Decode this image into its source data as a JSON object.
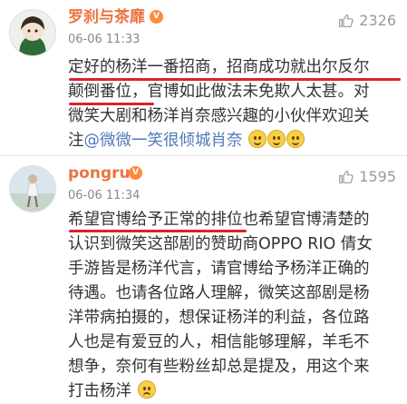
{
  "comments": [
    {
      "username": "罗刹与茶靡",
      "time": "06-06 11:33",
      "likes": "2326",
      "lines": [
        [
          "定好的杨洋一番招商，招商成功就出尔反尔"
        ],
        [
          "颠倒番位，",
          "官博如此做法未免欺人太甚。对"
        ],
        [
          "微笑大剧和杨洋肖奈感兴趣的小伙伴欢迎关"
        ],
        [
          "注",
          "@微微一笑很倾城肖奈"
        ]
      ]
    },
    {
      "username": "pongru",
      "time": "06-06 11:34",
      "likes": "1595",
      "lines": [
        [
          "希望官博给予正常的排位",
          "也希望官博清楚的"
        ],
        [
          "认识到微笑这部剧的赞助商OPPO RIO 倩女"
        ],
        [
          "手游皆是杨洋代言，请官博给予杨洋正确的"
        ],
        [
          "待遇。也请各位路人理解，微笑这部剧是杨"
        ],
        [
          "洋带病拍摄的，想保证杨洋的利益，各位路"
        ],
        [
          "人也是有爱豆的人，相信能够理解，羊毛不"
        ],
        [
          "想争，奈何有些粉丝却总是提及，用这个来"
        ],
        [
          "打击杨洋"
        ]
      ]
    }
  ],
  "icons": {
    "like": "thumbs-up-icon",
    "vip": "vip-badge-icon",
    "smile": "smile-emoji-icon",
    "sad": "sad-emoji-icon"
  }
}
